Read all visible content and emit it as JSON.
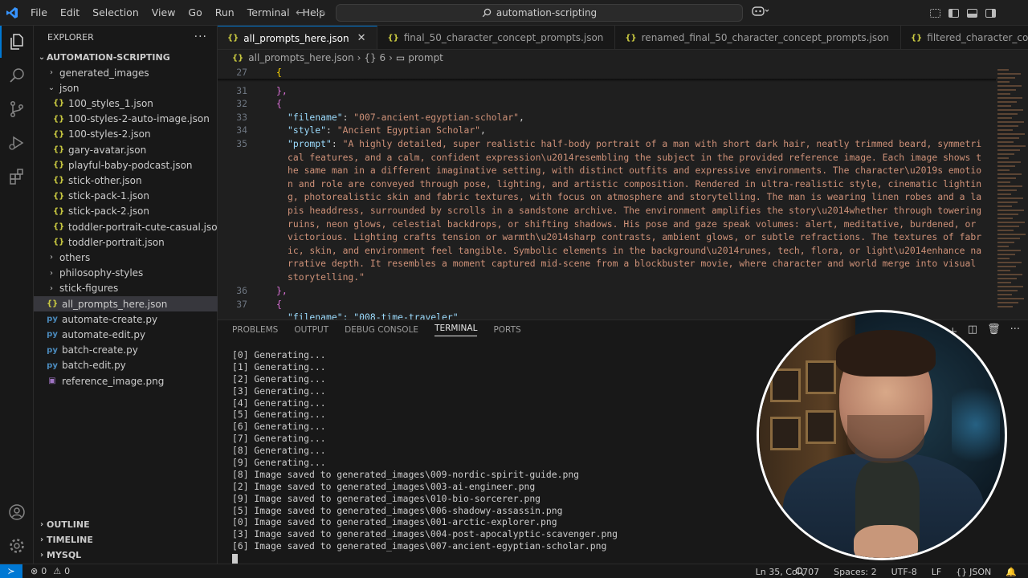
{
  "menu": [
    "File",
    "Edit",
    "Selection",
    "View",
    "Go",
    "Run",
    "Terminal",
    "Help"
  ],
  "search": {
    "text": "automation-scripting"
  },
  "explorer": {
    "title": "EXPLORER",
    "root": "AUTOMATION-SCRIPTING",
    "items": [
      {
        "label": "generated_images",
        "kind": "folder",
        "depth": 1,
        "open": false
      },
      {
        "label": "json",
        "kind": "folder",
        "depth": 1,
        "open": true
      },
      {
        "label": "100_styles_1.json",
        "kind": "json",
        "depth": 2
      },
      {
        "label": "100-styles-2-auto-image.json",
        "kind": "json",
        "depth": 2
      },
      {
        "label": "100-styles-2.json",
        "kind": "json",
        "depth": 2
      },
      {
        "label": "gary-avatar.json",
        "kind": "json",
        "depth": 2
      },
      {
        "label": "playful-baby-podcast.json",
        "kind": "json",
        "depth": 2
      },
      {
        "label": "stick-other.json",
        "kind": "json",
        "depth": 2
      },
      {
        "label": "stick-pack-1.json",
        "kind": "json",
        "depth": 2
      },
      {
        "label": "stick-pack-2.json",
        "kind": "json",
        "depth": 2
      },
      {
        "label": "toddler-portrait-cute-casual.json",
        "kind": "json",
        "depth": 2
      },
      {
        "label": "toddler-portrait.json",
        "kind": "json",
        "depth": 2
      },
      {
        "label": "others",
        "kind": "folder",
        "depth": 1,
        "open": false
      },
      {
        "label": "philosophy-styles",
        "kind": "folder",
        "depth": 1,
        "open": false
      },
      {
        "label": "stick-figures",
        "kind": "folder",
        "depth": 1,
        "open": false
      },
      {
        "label": "all_prompts_here.json",
        "kind": "json",
        "depth": 1,
        "selected": true
      },
      {
        "label": "automate-create.py",
        "kind": "py",
        "depth": 1
      },
      {
        "label": "automate-edit.py",
        "kind": "py",
        "depth": 1
      },
      {
        "label": "batch-create.py",
        "kind": "py",
        "depth": 1
      },
      {
        "label": "batch-edit.py",
        "kind": "py",
        "depth": 1
      },
      {
        "label": "reference_image.png",
        "kind": "png",
        "depth": 1
      }
    ],
    "sections": [
      "OUTLINE",
      "TIMELINE",
      "MYSQL"
    ]
  },
  "tabs": [
    {
      "label": "all_prompts_here.json",
      "active": true
    },
    {
      "label": "final_50_character_concept_prompts.json",
      "active": false
    },
    {
      "label": "renamed_final_50_character_concept_prompts.json",
      "active": false
    },
    {
      "label": "filtered_character_concept_prompts.json",
      "active": false
    }
  ],
  "breadcrumbs": {
    "file": "all_prompts_here.json",
    "node": "{} 6",
    "leaf": "prompt"
  },
  "code": {
    "line_numbers": [
      "27",
      "31",
      "32",
      "33",
      "34",
      "35",
      "36",
      "37"
    ],
    "l27": "{",
    "l31": "},",
    "l32": "{",
    "filename_key": "\"filename\"",
    "filename_val": "\"007-ancient-egyptian-scholar\"",
    "style_key": "\"style\"",
    "style_val": "\"Ancient Egyptian Scholar\"",
    "prompt_key": "\"prompt\"",
    "prompt_val": "\"A highly detailed, super realistic half-body portrait of a man with short dark hair, neatly trimmed beard, symmetrical features, and a calm, confident expression\\u2014resembling the subject in the provided reference image. Each image shows the same man in a different imaginative setting, with distinct outfits and expressive environments. The character\\u2019s emotion and role are conveyed through pose, lighting, and artistic composition. Rendered in ultra-realistic style, cinematic lighting, photorealistic skin and fabric textures, with focus on atmosphere and storytelling. The man is wearing linen robes and a lapis headdress, surrounded by scrolls in a sandstone archive. The environment amplifies the story\\u2014whether through towering ruins, neon glows, celestial backdrops, or shifting shadows. His pose and gaze speak volumes: alert, meditative, burdened, or victorious. Lighting crafts tension or warmth\\u2014sharp contrasts, ambient glows, or subtle refractions. The textures of fabric, skin, and environment feel tangible. Symbolic elements in the background\\u2014runes, tech, flora, or light\\u2014enhance narrative depth. It resembles a moment captured mid-scene from a blockbuster movie, where character and world merge into visual storytelling.\"",
    "l36": "},",
    "l37": "{",
    "l38_partial": "\"filename\": \"008-time-traveler\""
  },
  "panel": {
    "tabs": [
      "PROBLEMS",
      "OUTPUT",
      "DEBUG CONSOLE",
      "TERMINAL",
      "PORTS"
    ],
    "active_tab": "TERMINAL",
    "terminal_lines": [
      "[0] Generating...",
      "[1] Generating...",
      "[2] Generating...",
      "[3] Generating...",
      "[4] Generating...",
      "[5] Generating...",
      "[6] Generating...",
      "[7] Generating...",
      "[8] Generating...",
      "[9] Generating...",
      "[8] Image saved to generated_images\\009-nordic-spirit-guide.png",
      "[2] Image saved to generated_images\\003-ai-engineer.png",
      "[9] Image saved to generated_images\\010-bio-sorcerer.png",
      "[5] Image saved to generated_images\\006-shadowy-assassin.png",
      "[0] Image saved to generated_images\\001-arctic-explorer.png",
      "[3] Image saved to generated_images\\004-post-apocalyptic-scavenger.png",
      "[6] Image saved to generated_images\\007-ancient-egyptian-scholar.png"
    ]
  },
  "status": {
    "errors": "0",
    "warnings": "0",
    "position": "Ln 35, Col 707",
    "spaces": "Spaces: 2",
    "encoding": "UTF-8",
    "eol": "LF",
    "language": "JSON"
  },
  "colors": {
    "accent": "#0078d4",
    "json_icon": "#cbcb41",
    "string": "#ce9178",
    "key": "#9cdcfe"
  }
}
